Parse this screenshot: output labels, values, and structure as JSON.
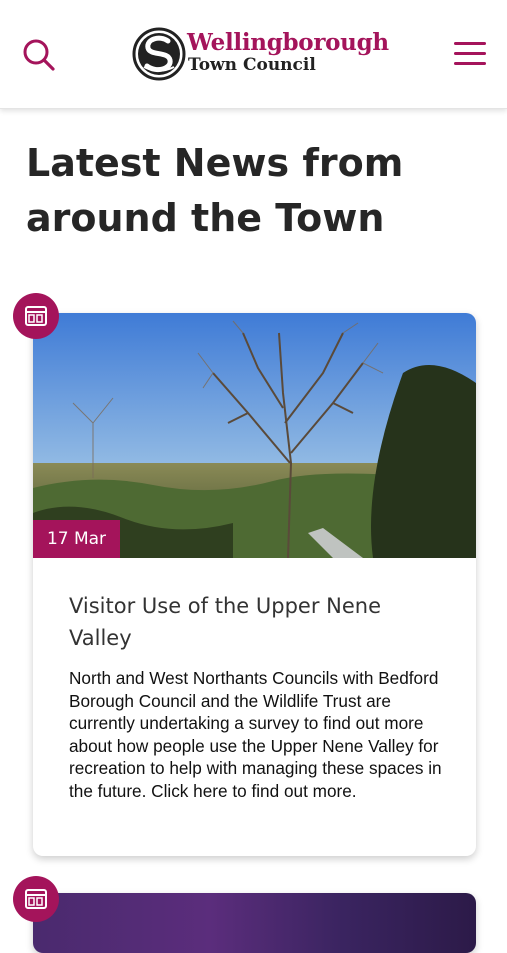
{
  "header": {
    "org_name_line1": "Wellingborough",
    "org_name_line2": "Town Council",
    "search_icon": "search-icon",
    "menu_icon": "hamburger-menu-icon"
  },
  "page": {
    "title": "Latest News from around the Town"
  },
  "news": [
    {
      "date": "17 Mar",
      "title": "Visitor Use of the Upper Nene Valley",
      "body": "North and West Northants Councils with Bedford Borough Council and the Wildlife Trust are currently undertaking a survey to find out more about how people use the Upper Nene Valley for recreation to help with managing these spaces in the future. Click here to find out more.",
      "icon": "calendar-icon"
    },
    {
      "icon": "calendar-icon"
    }
  ],
  "colors": {
    "brand": "#a4145b",
    "text": "#262626"
  }
}
